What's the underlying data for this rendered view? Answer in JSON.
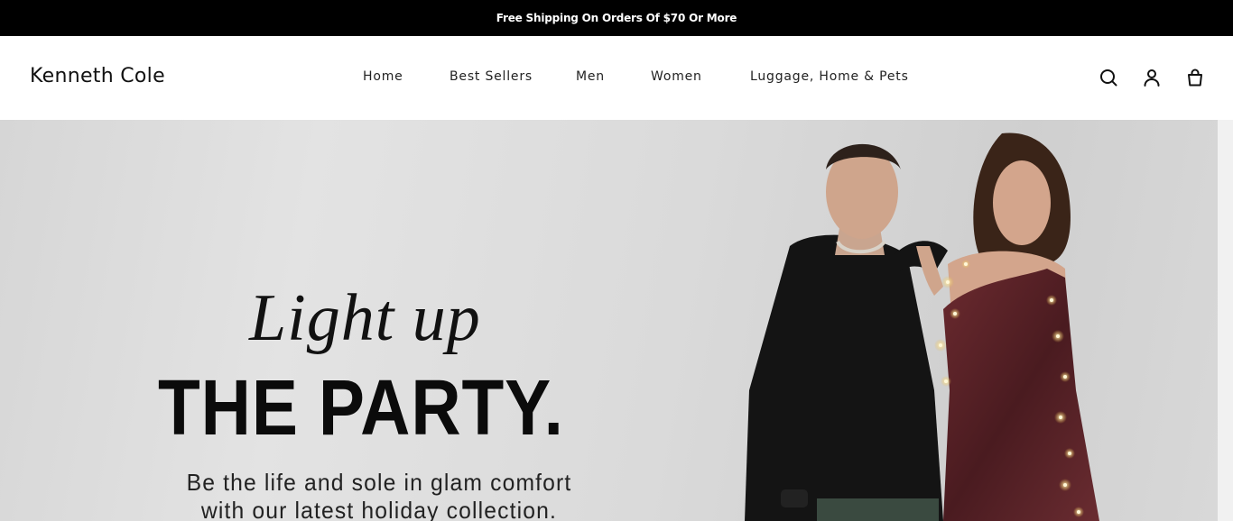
{
  "announcement": {
    "text": "Free Shipping On Orders Of $70 Or More"
  },
  "header": {
    "logo": "Kenneth Cole",
    "nav": [
      {
        "label": "Home"
      },
      {
        "label": "Best Sellers"
      },
      {
        "label": "Men"
      },
      {
        "label": "Women"
      },
      {
        "label": "Luggage, Home & Pets"
      }
    ],
    "icons": [
      "search-icon",
      "account-icon",
      "cart-icon"
    ]
  },
  "hero": {
    "script_line": "Light up",
    "headline": "THE PARTY.",
    "subtext": "Be the life and sole in glam comfort with our latest holiday collection."
  },
  "colors": {
    "announcement_bg": "#000000",
    "announcement_text": "#ffffff",
    "hero_bg": "#dcdcdc",
    "dress": "#5a2328"
  }
}
